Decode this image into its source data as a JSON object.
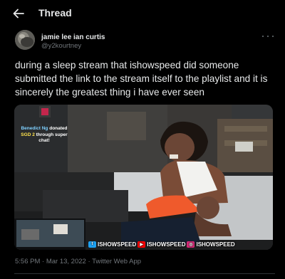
{
  "header": {
    "title": "Thread",
    "back_icon": "arrow-left-icon"
  },
  "tweet": {
    "author_name": "jamie lee ian curtis",
    "author_handle": "@y2kourtney",
    "text": "during a sleep stream that ishowspeed did someone submitted the link to the stream itself to the playlist and it is sincerely the greatest thing i have ever seen",
    "timestamp": "5:56 PM · Mar 13, 2022 · Twitter Web App"
  },
  "media": {
    "donation": {
      "donor": "Benedict Ng",
      "action": "donated",
      "amount": "SGD 2",
      "line3": "through super",
      "line4": "chat!"
    },
    "social_twitter": "ISHOWSPEED",
    "social_youtube": "ISHOWSPEED",
    "social_instagram": "ISHOWSPEED",
    "colors": {
      "twitter": "#1da1f2",
      "youtube": "#ff0000",
      "instagram": "#d62976"
    }
  },
  "colors": {
    "background": "#000000",
    "text": "#e7e9ea",
    "muted": "#71767b"
  }
}
